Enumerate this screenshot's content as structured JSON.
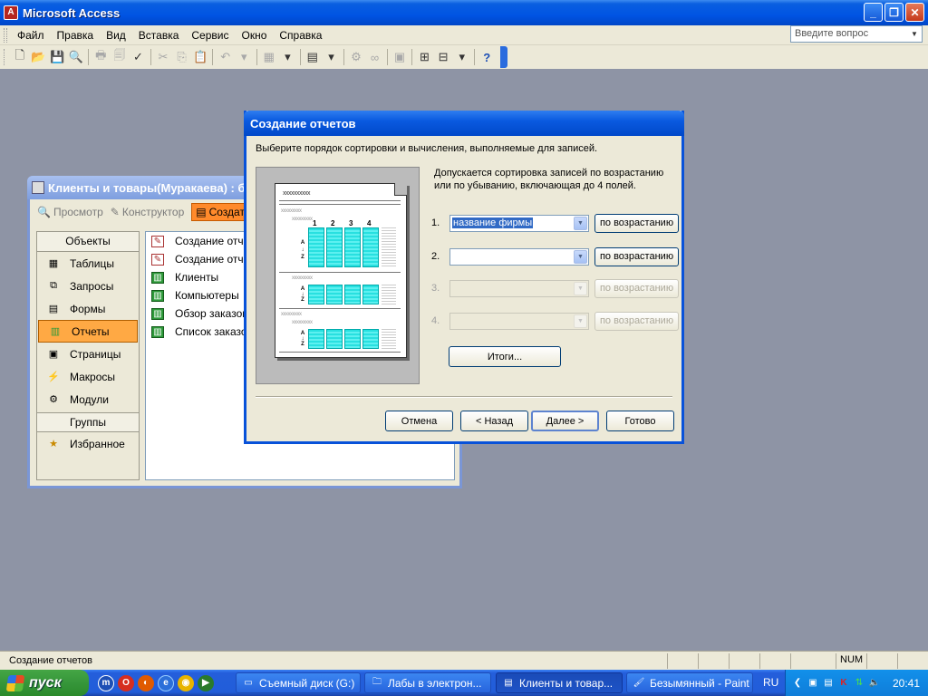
{
  "app": {
    "title": "Microsoft Access",
    "icon_letter": "A"
  },
  "menu": {
    "items": [
      "Файл",
      "Правка",
      "Вид",
      "Вставка",
      "Сервис",
      "Окно",
      "Справка"
    ],
    "help_placeholder": "Введите вопрос"
  },
  "db_window": {
    "title": "Клиенты и товары(Муракаева) : б",
    "toolbar": {
      "preview": "Просмотр",
      "design": "Конструктор",
      "create": "Создать"
    },
    "objects_header": "Объекты",
    "objects": [
      {
        "label": "Таблицы",
        "icon": "table-icon"
      },
      {
        "label": "Запросы",
        "icon": "query-icon"
      },
      {
        "label": "Формы",
        "icon": "form-icon"
      },
      {
        "label": "Отчеты",
        "icon": "report-icon",
        "selected": true
      },
      {
        "label": "Страницы",
        "icon": "page-icon"
      },
      {
        "label": "Макросы",
        "icon": "macro-icon"
      },
      {
        "label": "Модули",
        "icon": "module-icon"
      }
    ],
    "groups_header": "Группы",
    "groups": [
      {
        "label": "Избранное",
        "icon": "favorites-icon"
      }
    ],
    "list": [
      {
        "label": "Создание отчета",
        "kind": "wizard"
      },
      {
        "label": "Создание отчета",
        "kind": "wizard"
      },
      {
        "label": "Клиенты",
        "kind": "report"
      },
      {
        "label": "Компьютеры",
        "kind": "report"
      },
      {
        "label": "Обзор заказов",
        "kind": "report"
      },
      {
        "label": "Список заказов",
        "kind": "report"
      }
    ]
  },
  "wizard": {
    "title": "Создание отчетов",
    "prompt": "Выберите порядок сортировки и вычисления, выполняемые для записей.",
    "info": "Допускается сортировка записей по возрастанию или по убыванию, включающая до 4 полей.",
    "preview": {
      "title_marks": "xxxxxxxxxx",
      "group_marks": "xxxxxxxxx",
      "columns": [
        "1",
        "2",
        "3",
        "4"
      ],
      "sort_a": "A",
      "sort_z": "Z"
    },
    "sort_rows": [
      {
        "num": "1.",
        "value": "название фирмы",
        "order": "по возрастанию",
        "enabled": true
      },
      {
        "num": "2.",
        "value": "",
        "order": "по возрастанию",
        "enabled": true
      },
      {
        "num": "3.",
        "value": "",
        "order": "по возрастанию",
        "enabled": false
      },
      {
        "num": "4.",
        "value": "",
        "order": "по возрастанию",
        "enabled": false
      }
    ],
    "totals_button": "Итоги...",
    "buttons": {
      "cancel": "Отмена",
      "back": "< Назад",
      "next": "Далее >",
      "finish": "Готово"
    }
  },
  "statusbar": {
    "text": "Создание отчетов",
    "num": "NUM"
  },
  "taskbar": {
    "start": "пуск",
    "tasks": [
      {
        "label": "Съемный диск (G:)",
        "icon": "drive-icon"
      },
      {
        "label": "Лабы в электрон...",
        "icon": "folder-icon"
      },
      {
        "label": "Клиенты и товар...",
        "icon": "access-icon",
        "active": true
      },
      {
        "label": "Безымянный - Paint",
        "icon": "paint-icon"
      }
    ],
    "lang": "RU",
    "clock": "20:41"
  }
}
